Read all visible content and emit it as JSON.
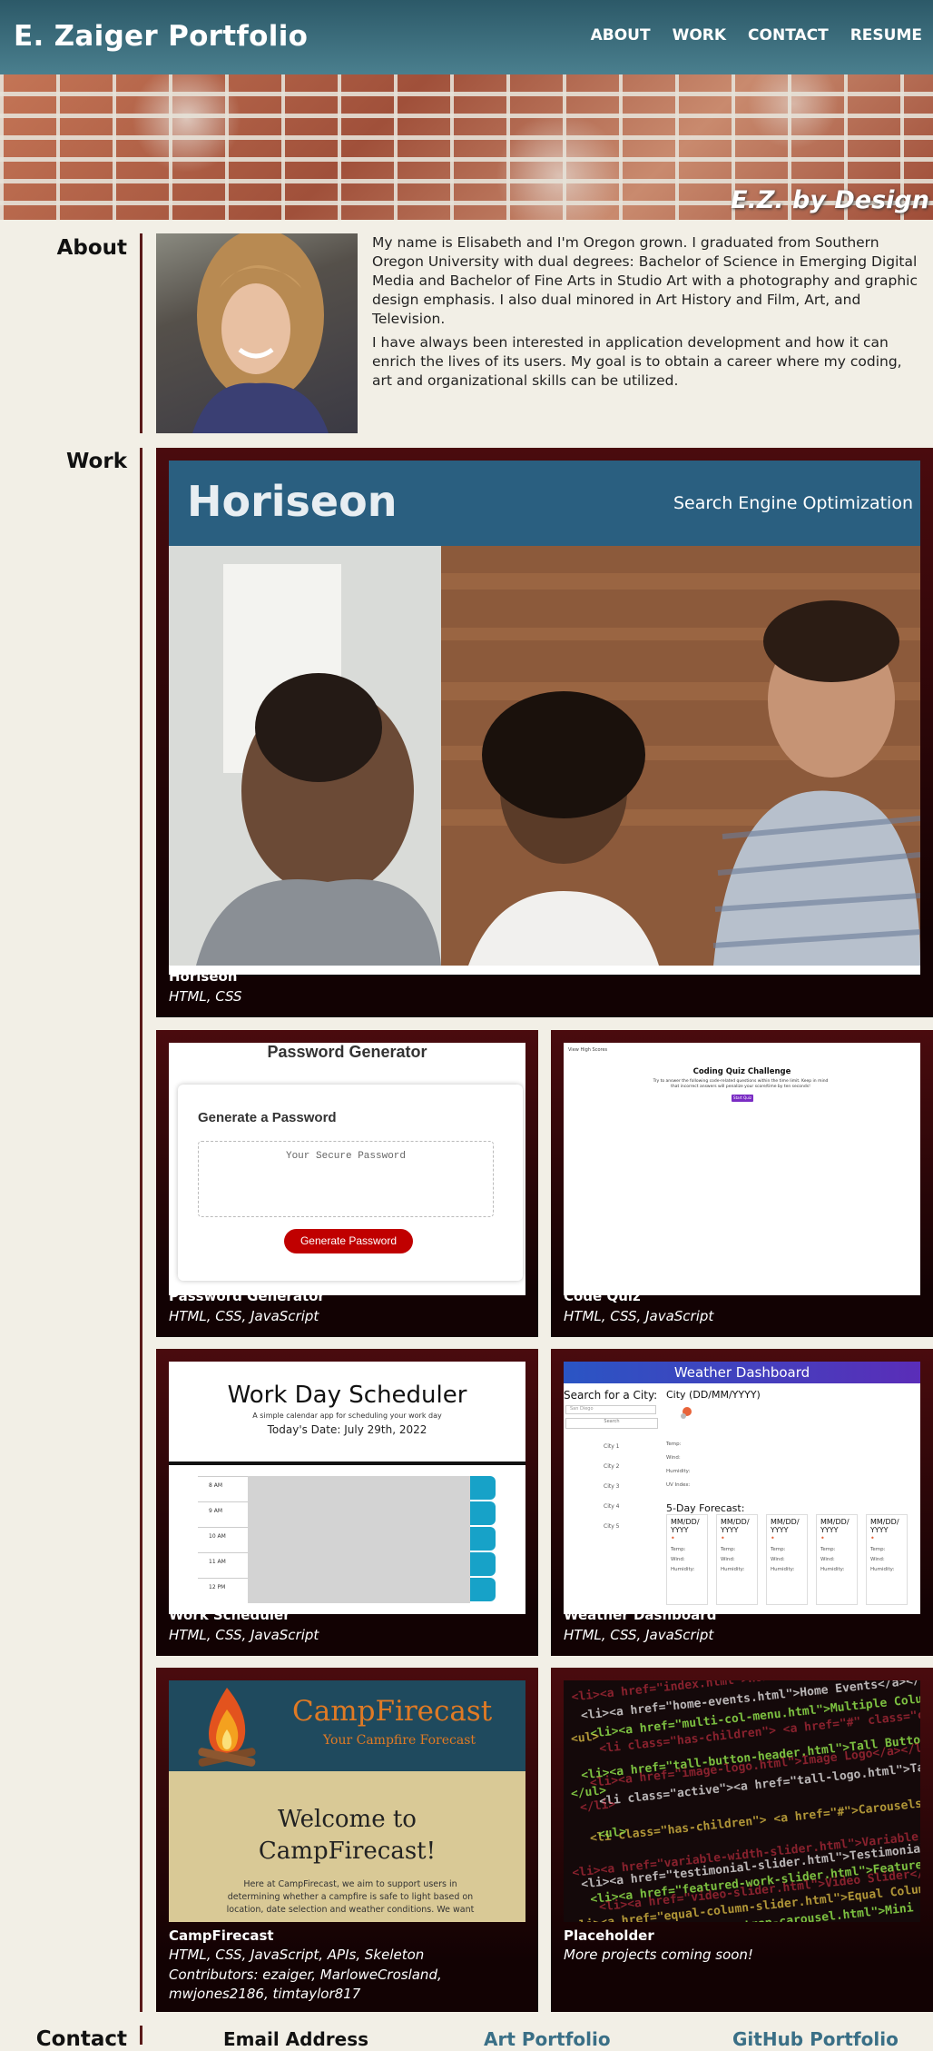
{
  "header": {
    "brand": "E. Zaiger Portfolio",
    "nav": [
      "ABOUT",
      "WORK",
      "CONTACT",
      "RESUME"
    ]
  },
  "hero": {
    "tagline": "E.Z. by Design"
  },
  "about": {
    "label": "About",
    "paragraphs": [
      "My name is Elisabeth and I'm Oregon grown. I graduated from Southern Oregon University with dual degrees: Bachelor of Science in Emerging Digital Media and Bachelor of Fine Arts in Studio Art with a photography and graphic design emphasis. I also dual minored in Art History and Film, Art, and Television.",
      "I have always been interested in application development and how it can enrich the lives of its users. My goal is to obtain a career where my coding, art and organizational skills can be utilized."
    ]
  },
  "work": {
    "label": "Work",
    "projects": [
      {
        "title": "Horiseon",
        "tech": "HTML, CSS"
      },
      {
        "title": "Password Generator",
        "tech": "HTML, CSS, JavaScript"
      },
      {
        "title": "Code Quiz",
        "tech": "HTML, CSS, JavaScript"
      },
      {
        "title": "Work Scheduler",
        "tech": "HTML, CSS, JavaScript"
      },
      {
        "title": "Weather Dashboard",
        "tech": "HTML, CSS, JavaScript"
      },
      {
        "title": "CampFirecast",
        "tech": "HTML, CSS, JavaScript, APIs, Skeleton",
        "contributors": "Contributors: ezaiger, MarloweCrosland, mwjones2186, timtaylor817"
      },
      {
        "title": "Placeholder",
        "tech": "More projects coming soon!"
      }
    ],
    "horiseon_shot": {
      "logo": "Horiseon",
      "subtitle": "Search Engine Optimization"
    },
    "password_shot": {
      "title": "Password Generator",
      "heading": "Generate a Password",
      "placeholder": "Your Secure Password",
      "button": "Generate Password"
    },
    "quiz_shot": {
      "highscores": "View High Scores",
      "title": "Coding Quiz Challenge",
      "desc": "Try to answer the following code-related questions within the time limit. Keep in mind that incorrect answers will penalize your score/time by ten seconds!",
      "button": "Start Quiz"
    },
    "scheduler_shot": {
      "title": "Work Day Scheduler",
      "subtitle": "A simple calendar app for scheduling your work day",
      "date": "Today's Date: July 29th, 2022",
      "hours": [
        "8 AM",
        "9 AM",
        "10 AM",
        "11 AM",
        "12 PM"
      ]
    },
    "weather_shot": {
      "title": "Weather Dashboard",
      "search_label": "Search for a City:",
      "input_placeholder": "San Diego",
      "search_button": "Search",
      "cities": [
        "City 1",
        "City 2",
        "City 3",
        "City 4",
        "City 5"
      ],
      "current": "City (DD/MM/YYYY)",
      "current_fields": [
        "Temp:",
        "Wind:",
        "Humidity:",
        "UV Index:"
      ],
      "forecast_label": "5-Day Forecast:",
      "forecast_date": "MM/DD/ YYYY",
      "forecast_fields": [
        "Temp:",
        "Wind:",
        "Humidity:"
      ]
    },
    "camp_shot": {
      "name": "CampFirecast",
      "tagline": "Your Campfire Forecast",
      "welcome_1": "Welcome to",
      "welcome_2": "CampFirecast!",
      "text": "Here at CampFirecast, we aim to support users in determining whether a campfire is safe to light based on location, date selection and weather conditions. We want our campers to be fire conscious"
    },
    "placeholder_code": [
      "<li><a href=\"index.html\">Home</a></li>",
      "<li><a href=\"home-events.html\">Home Events</a></li>",
      "<li><a href=\"multi-col-menu.html\">Multiple Column Menu</a></li>",
      "<li class=\"has-children\"> <a href=\"#\" class=\"current\">Carousels</a>",
      "<ul>",
      "<li><a href=\"tall-button-header.html\">Tall Button Header</a></li>",
      "<li><a href=\"image-logo.html\">Image Logo</a></li>",
      "<li class=\"active\"><a href=\"tall-logo.html\">Tall Logo</a></li>",
      "</ul>",
      "</li>",
      "<li class=\"has-children\"> <a href=\"#\">Carousels</a>",
      "<ul>",
      "<li><a href=\"variable-width-slider.html\">Variable Width Slider</a></li>",
      "<li><a href=\"testimonial-slider.html\">Testimonial Slider</a></li>",
      "<li><a href=\"featured-work-slider.html\">Featured Work Slider</a></li>",
      "<li><a href=\"video-slider.html\">Video Slider</a></li>",
      "<li><a href=\"equal-column-slider.html\">Equal Column Slider</a></li>",
      "<li><a href=\"mini-bootstrap-carousel.html\">Mini Bootstrap Carousel</a></li>"
    ]
  },
  "contact": {
    "label": "Contact",
    "items": [
      "Email Address",
      "Art Portfolio",
      "GitHub Portfolio"
    ]
  },
  "colors": {
    "header": "#3f7282",
    "rule": "#5a1a1a",
    "card": "#3a0709",
    "link": "#3a6f86"
  }
}
